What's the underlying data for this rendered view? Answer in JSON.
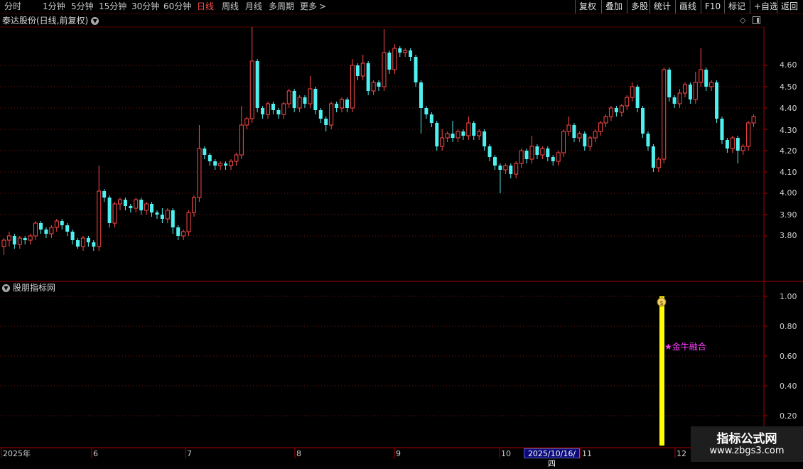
{
  "toolbar": {
    "periods": [
      "分时",
      "1分钟",
      "5分钟",
      "15分钟",
      "30分钟",
      "60分钟",
      "日线",
      "周线",
      "月线",
      "多周期",
      "更多"
    ],
    "active_period": "日线",
    "right_buttons": [
      "复权",
      "叠加",
      "多股",
      "统计",
      "画线",
      "F10",
      "+自选",
      "返回"
    ]
  },
  "main_chart": {
    "title": "泰达股份(日线,前复权)",
    "y_labels": [
      "4.60",
      "4.50",
      "4.40",
      "4.30",
      "4.20",
      "4.10",
      "4.00",
      "3.90",
      "3.80"
    ]
  },
  "indicator": {
    "title": "股朋指标网",
    "y_labels": [
      "1.00",
      "0.80",
      "0.60",
      "0.40",
      "0.20"
    ],
    "signal_label": "★金牛融合",
    "signal_value": 1.0
  },
  "x_axis": {
    "labels": [
      "2025年",
      "6",
      "7",
      "8",
      "9",
      "10",
      "11",
      "12"
    ],
    "cursor_date": "2025/10/16/四"
  },
  "watermark": {
    "line1": "指标公式网",
    "line2": "www.zbgs3.com"
  },
  "colors": {
    "up": "#ff4a4a",
    "down": "#50f0f0",
    "signal": "#ffff00",
    "signal_text": "#ff40ff",
    "axis": "#aa0000"
  },
  "chart_data": {
    "type": "candlestick",
    "ylim": [
      3.7,
      4.72
    ],
    "candles": [
      [
        3.75,
        3.78,
        3.73,
        3.71,
        3.79
      ],
      [
        3.78,
        3.8,
        3.76,
        3.75,
        3.82
      ],
      [
        3.8,
        3.76,
        3.75,
        3.74,
        3.81
      ],
      [
        3.76,
        3.79,
        3.75,
        3.74,
        3.8
      ],
      [
        3.79,
        3.78,
        3.77,
        3.76,
        3.8
      ],
      [
        3.78,
        3.8,
        3.77,
        3.76,
        3.81
      ],
      [
        3.8,
        3.86,
        3.79,
        3.78,
        3.87
      ],
      [
        3.86,
        3.83,
        3.82,
        3.81,
        3.87
      ],
      [
        3.83,
        3.81,
        3.8,
        3.79,
        3.84
      ],
      [
        3.81,
        3.84,
        3.8,
        3.79,
        3.85
      ],
      [
        3.84,
        3.87,
        3.83,
        3.82,
        3.88
      ],
      [
        3.87,
        3.85,
        3.84,
        3.83,
        3.88
      ],
      [
        3.85,
        3.82,
        3.81,
        3.8,
        3.86
      ],
      [
        3.82,
        3.78,
        3.77,
        3.76,
        3.83
      ],
      [
        3.78,
        3.75,
        3.75,
        3.74,
        3.79
      ],
      [
        3.75,
        3.79,
        3.74,
        3.73,
        3.8
      ],
      [
        3.79,
        3.77,
        3.76,
        3.75,
        3.8
      ],
      [
        3.77,
        3.75,
        3.74,
        3.73,
        3.78
      ],
      [
        3.75,
        4.01,
        3.74,
        3.73,
        4.13
      ],
      [
        4.01,
        3.98,
        3.97,
        3.96,
        4.02
      ],
      [
        3.98,
        3.86,
        3.85,
        3.84,
        3.99
      ],
      [
        3.86,
        3.95,
        3.85,
        3.84,
        3.96
      ],
      [
        3.95,
        3.97,
        3.94,
        3.92,
        3.98
      ],
      [
        3.97,
        3.94,
        3.93,
        3.92,
        3.98
      ],
      [
        3.94,
        3.93,
        3.92,
        3.91,
        3.95
      ],
      [
        3.93,
        3.97,
        3.92,
        3.91,
        3.98
      ],
      [
        3.97,
        3.92,
        3.91,
        3.9,
        3.98
      ],
      [
        3.92,
        3.95,
        3.91,
        3.9,
        3.96
      ],
      [
        3.95,
        3.91,
        3.9,
        3.89,
        3.96
      ],
      [
        3.91,
        3.9,
        3.89,
        3.88,
        3.92
      ],
      [
        3.9,
        3.88,
        3.87,
        3.86,
        3.93
      ],
      [
        3.88,
        3.92,
        3.87,
        3.86,
        3.93
      ],
      [
        3.92,
        3.84,
        3.83,
        3.81,
        3.93
      ],
      [
        3.84,
        3.8,
        3.79,
        3.78,
        3.85
      ],
      [
        3.8,
        3.82,
        3.79,
        3.78,
        3.83
      ],
      [
        3.82,
        3.91,
        3.81,
        3.8,
        3.92
      ],
      [
        3.91,
        3.98,
        3.9,
        3.89,
        3.99
      ],
      [
        3.98,
        4.21,
        3.97,
        3.96,
        4.32
      ],
      [
        4.21,
        4.18,
        4.17,
        4.16,
        4.22
      ],
      [
        4.18,
        4.15,
        4.14,
        4.13,
        4.19
      ],
      [
        4.15,
        4.13,
        4.12,
        4.11,
        4.16
      ],
      [
        4.13,
        4.14,
        4.12,
        4.11,
        4.15
      ],
      [
        4.14,
        4.13,
        4.12,
        4.11,
        4.15
      ],
      [
        4.13,
        4.15,
        4.12,
        4.11,
        4.16
      ],
      [
        4.15,
        4.18,
        4.14,
        4.13,
        4.19
      ],
      [
        4.18,
        4.32,
        4.17,
        4.16,
        4.41
      ],
      [
        4.32,
        4.35,
        4.31,
        4.3,
        4.36
      ],
      [
        4.35,
        4.62,
        4.34,
        4.33,
        4.78
      ],
      [
        4.62,
        4.4,
        4.39,
        4.38,
        4.63
      ],
      [
        4.4,
        4.37,
        4.36,
        4.35,
        4.41
      ],
      [
        4.37,
        4.42,
        4.36,
        4.35,
        4.43
      ],
      [
        4.42,
        4.39,
        4.38,
        4.37,
        4.43
      ],
      [
        4.39,
        4.37,
        4.36,
        4.35,
        4.4
      ],
      [
        4.37,
        4.42,
        4.36,
        4.35,
        4.43
      ],
      [
        4.42,
        4.48,
        4.41,
        4.4,
        4.49
      ],
      [
        4.48,
        4.4,
        4.39,
        4.38,
        4.49
      ],
      [
        4.4,
        4.45,
        4.39,
        4.38,
        4.46
      ],
      [
        4.45,
        4.42,
        4.41,
        4.4,
        4.46
      ],
      [
        4.42,
        4.49,
        4.41,
        4.4,
        4.55
      ],
      [
        4.49,
        4.39,
        4.38,
        4.37,
        4.5
      ],
      [
        4.39,
        4.35,
        4.34,
        4.33,
        4.4
      ],
      [
        4.35,
        4.32,
        4.31,
        4.29,
        4.36
      ],
      [
        4.32,
        4.42,
        4.31,
        4.3,
        4.43
      ],
      [
        4.42,
        4.4,
        4.39,
        4.38,
        4.43
      ],
      [
        4.4,
        4.44,
        4.39,
        4.38,
        4.45
      ],
      [
        4.44,
        4.4,
        4.39,
        4.38,
        4.45
      ],
      [
        4.4,
        4.6,
        4.39,
        4.38,
        4.63
      ],
      [
        4.6,
        4.55,
        4.54,
        4.53,
        4.61
      ],
      [
        4.55,
        4.61,
        4.54,
        4.53,
        4.65
      ],
      [
        4.61,
        4.48,
        4.47,
        4.46,
        4.62
      ],
      [
        4.48,
        4.52,
        4.47,
        4.46,
        4.53
      ],
      [
        4.52,
        4.5,
        4.49,
        4.48,
        4.53
      ],
      [
        4.5,
        4.66,
        4.49,
        4.48,
        4.77
      ],
      [
        4.66,
        4.58,
        4.57,
        4.56,
        4.67
      ],
      [
        4.58,
        4.68,
        4.57,
        4.56,
        4.7
      ],
      [
        4.68,
        4.66,
        4.65,
        4.64,
        4.69
      ],
      [
        4.66,
        4.67,
        4.65,
        4.64,
        4.68
      ],
      [
        4.67,
        4.64,
        4.63,
        4.62,
        4.68
      ],
      [
        4.64,
        4.52,
        4.51,
        4.5,
        4.65
      ],
      [
        4.52,
        4.4,
        4.39,
        4.28,
        4.53
      ],
      [
        4.4,
        4.37,
        4.36,
        4.35,
        4.41
      ],
      [
        4.37,
        4.33,
        4.32,
        4.31,
        4.38
      ],
      [
        4.33,
        4.22,
        4.21,
        4.2,
        4.34
      ],
      [
        4.22,
        4.26,
        4.21,
        4.2,
        4.3
      ],
      [
        4.26,
        4.28,
        4.25,
        4.24,
        4.29
      ],
      [
        4.28,
        4.26,
        4.25,
        4.24,
        4.34
      ],
      [
        4.26,
        4.29,
        4.25,
        4.24,
        4.3
      ],
      [
        4.29,
        4.27,
        4.26,
        4.25,
        4.3
      ],
      [
        4.27,
        4.33,
        4.26,
        4.25,
        4.36
      ],
      [
        4.33,
        4.27,
        4.26,
        4.25,
        4.34
      ],
      [
        4.27,
        4.29,
        4.26,
        4.25,
        4.3
      ],
      [
        4.29,
        4.22,
        4.21,
        4.2,
        4.3
      ],
      [
        4.22,
        4.17,
        4.16,
        4.15,
        4.23
      ],
      [
        4.17,
        4.13,
        4.12,
        4.11,
        4.18
      ],
      [
        4.13,
        4.11,
        4.1,
        4.0,
        4.14
      ],
      [
        4.11,
        4.13,
        4.1,
        4.09,
        4.14
      ],
      [
        4.13,
        4.09,
        4.08,
        4.07,
        4.14
      ],
      [
        4.09,
        4.14,
        4.08,
        4.07,
        4.15
      ],
      [
        4.14,
        4.2,
        4.13,
        4.12,
        4.21
      ],
      [
        4.2,
        4.16,
        4.15,
        4.14,
        4.21
      ],
      [
        4.16,
        4.22,
        4.15,
        4.14,
        4.27
      ],
      [
        4.22,
        4.18,
        4.17,
        4.16,
        4.23
      ],
      [
        4.18,
        4.21,
        4.17,
        4.16,
        4.22
      ],
      [
        4.21,
        4.17,
        4.16,
        4.15,
        4.22
      ],
      [
        4.17,
        4.15,
        4.14,
        4.13,
        4.18
      ],
      [
        4.15,
        4.19,
        4.14,
        4.13,
        4.2
      ],
      [
        4.19,
        4.29,
        4.18,
        4.17,
        4.3
      ],
      [
        4.29,
        4.32,
        4.28,
        4.27,
        4.36
      ],
      [
        4.32,
        4.26,
        4.25,
        4.24,
        4.33
      ],
      [
        4.26,
        4.28,
        4.25,
        4.24,
        4.29
      ],
      [
        4.28,
        4.22,
        4.21,
        4.2,
        4.29
      ],
      [
        4.22,
        4.26,
        4.21,
        4.2,
        4.27
      ],
      [
        4.26,
        4.29,
        4.25,
        4.24,
        4.3
      ],
      [
        4.29,
        4.33,
        4.28,
        4.27,
        4.34
      ],
      [
        4.33,
        4.36,
        4.32,
        4.31,
        4.37
      ],
      [
        4.36,
        4.4,
        4.35,
        4.34,
        4.41
      ],
      [
        4.4,
        4.38,
        4.37,
        4.36,
        4.41
      ],
      [
        4.38,
        4.41,
        4.37,
        4.36,
        4.42
      ],
      [
        4.41,
        4.45,
        4.4,
        4.39,
        4.46
      ],
      [
        4.45,
        4.5,
        4.44,
        4.43,
        4.52
      ],
      [
        4.5,
        4.4,
        4.39,
        4.38,
        4.51
      ],
      [
        4.4,
        4.28,
        4.27,
        4.26,
        4.41
      ],
      [
        4.28,
        4.22,
        4.21,
        4.2,
        4.29
      ],
      [
        4.22,
        4.12,
        4.11,
        4.1,
        4.23
      ],
      [
        4.12,
        4.16,
        4.11,
        4.1,
        4.17
      ],
      [
        4.16,
        4.58,
        4.15,
        4.14,
        4.59
      ],
      [
        4.58,
        4.45,
        4.44,
        4.43,
        4.59
      ],
      [
        4.45,
        4.42,
        4.41,
        4.4,
        4.46
      ],
      [
        4.42,
        4.47,
        4.41,
        4.4,
        4.49
      ],
      [
        4.47,
        4.51,
        4.46,
        4.45,
        4.52
      ],
      [
        4.51,
        4.44,
        4.43,
        4.42,
        4.52
      ],
      [
        4.44,
        4.52,
        4.43,
        4.42,
        4.57
      ],
      [
        4.52,
        4.58,
        4.51,
        4.5,
        4.68
      ],
      [
        4.58,
        4.5,
        4.49,
        4.48,
        4.59
      ],
      [
        4.5,
        4.52,
        4.49,
        4.48,
        4.53
      ],
      [
        4.52,
        4.35,
        4.34,
        4.33,
        4.53
      ],
      [
        4.35,
        4.25,
        4.24,
        4.23,
        4.36
      ],
      [
        4.25,
        4.21,
        4.2,
        4.19,
        4.26
      ],
      [
        4.21,
        4.26,
        4.2,
        4.19,
        4.27
      ],
      [
        4.26,
        4.2,
        4.19,
        4.14,
        4.27
      ],
      [
        4.2,
        4.22,
        4.19,
        4.18,
        4.23
      ],
      [
        4.22,
        4.33,
        4.21,
        4.2,
        4.34
      ],
      [
        4.33,
        4.36,
        4.32,
        4.31,
        4.37
      ]
    ]
  }
}
